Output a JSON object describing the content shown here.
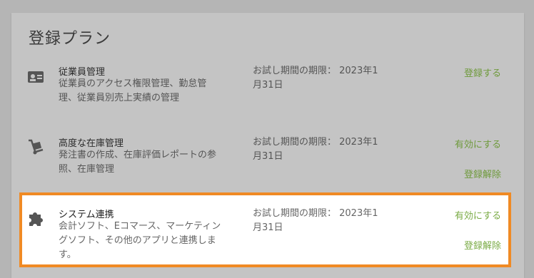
{
  "title": "登録プラン",
  "plans": [
    {
      "name": "従業員管理",
      "desc": "従業員のアクセス権限管理、勤怠管理、従業員別売上実績の管理",
      "trial": "お試し期間の期限： 2023年1月31日",
      "actions": [
        "登録する"
      ]
    },
    {
      "name": "高度な在庫管理",
      "desc": "発注書の作成、在庫評価レポートの参照、在庫管理",
      "trial": "お試し期間の期限： 2023年1月31日",
      "actions": [
        "有効にする",
        "登録解除"
      ]
    },
    {
      "name": "システム連携",
      "desc": "会計ソフト、Eコマース、マーケティングソフト、その他のアプリと連携します。",
      "trial": "お試し期間の期限： 2023年1月31日",
      "actions": [
        "有効にする",
        "登録解除"
      ]
    }
  ],
  "icons": [
    "id-card-icon",
    "hand-truck-icon",
    "puzzle-piece-icon"
  ],
  "colors": {
    "action": "#6f9a3c",
    "highlight": "#f08a24"
  }
}
